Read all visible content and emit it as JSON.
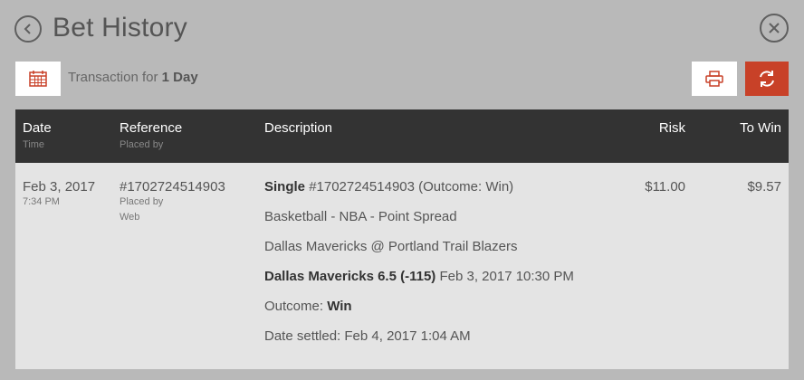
{
  "header": {
    "title": "Bet History"
  },
  "toolbar": {
    "transaction_prefix": "Transaction for",
    "transaction_period": "1 Day"
  },
  "table": {
    "columns": {
      "date": "Date",
      "date_sub": "Time",
      "reference": "Reference",
      "reference_sub": "Placed by",
      "description": "Description",
      "risk": "Risk",
      "to_win": "To Win"
    },
    "rows": [
      {
        "date": "Feb 3, 2017",
        "time": "7:34 PM",
        "reference": "#1702724514903",
        "placed_by_label": "Placed by",
        "placed_by": "Web",
        "bet_type": "Single",
        "bet_ref_outcome": "#1702724514903 (Outcome: Win)",
        "sport_line": "Basketball - NBA - Point Spread",
        "matchup": "Dallas Mavericks @ Portland Trail Blazers",
        "selection": "Dallas Mavericks 6.5 (-115)",
        "event_datetime": "Feb 3, 2017 10:30 PM",
        "outcome_label": "Outcome:",
        "outcome": "Win",
        "date_settled": "Date settled: Feb 4, 2017 1:04 AM",
        "risk": "$11.00",
        "to_win": "$9.57"
      }
    ]
  },
  "icons": {
    "back": "chevron-left-circle-icon",
    "close": "close-circle-icon",
    "calendar": "calendar-icon",
    "print": "printer-icon",
    "refresh": "refresh-icon"
  },
  "colors": {
    "background": "#b9b9b9",
    "table_header": "#333333",
    "table_body": "#e4e4e4",
    "accent": "#c84128"
  }
}
